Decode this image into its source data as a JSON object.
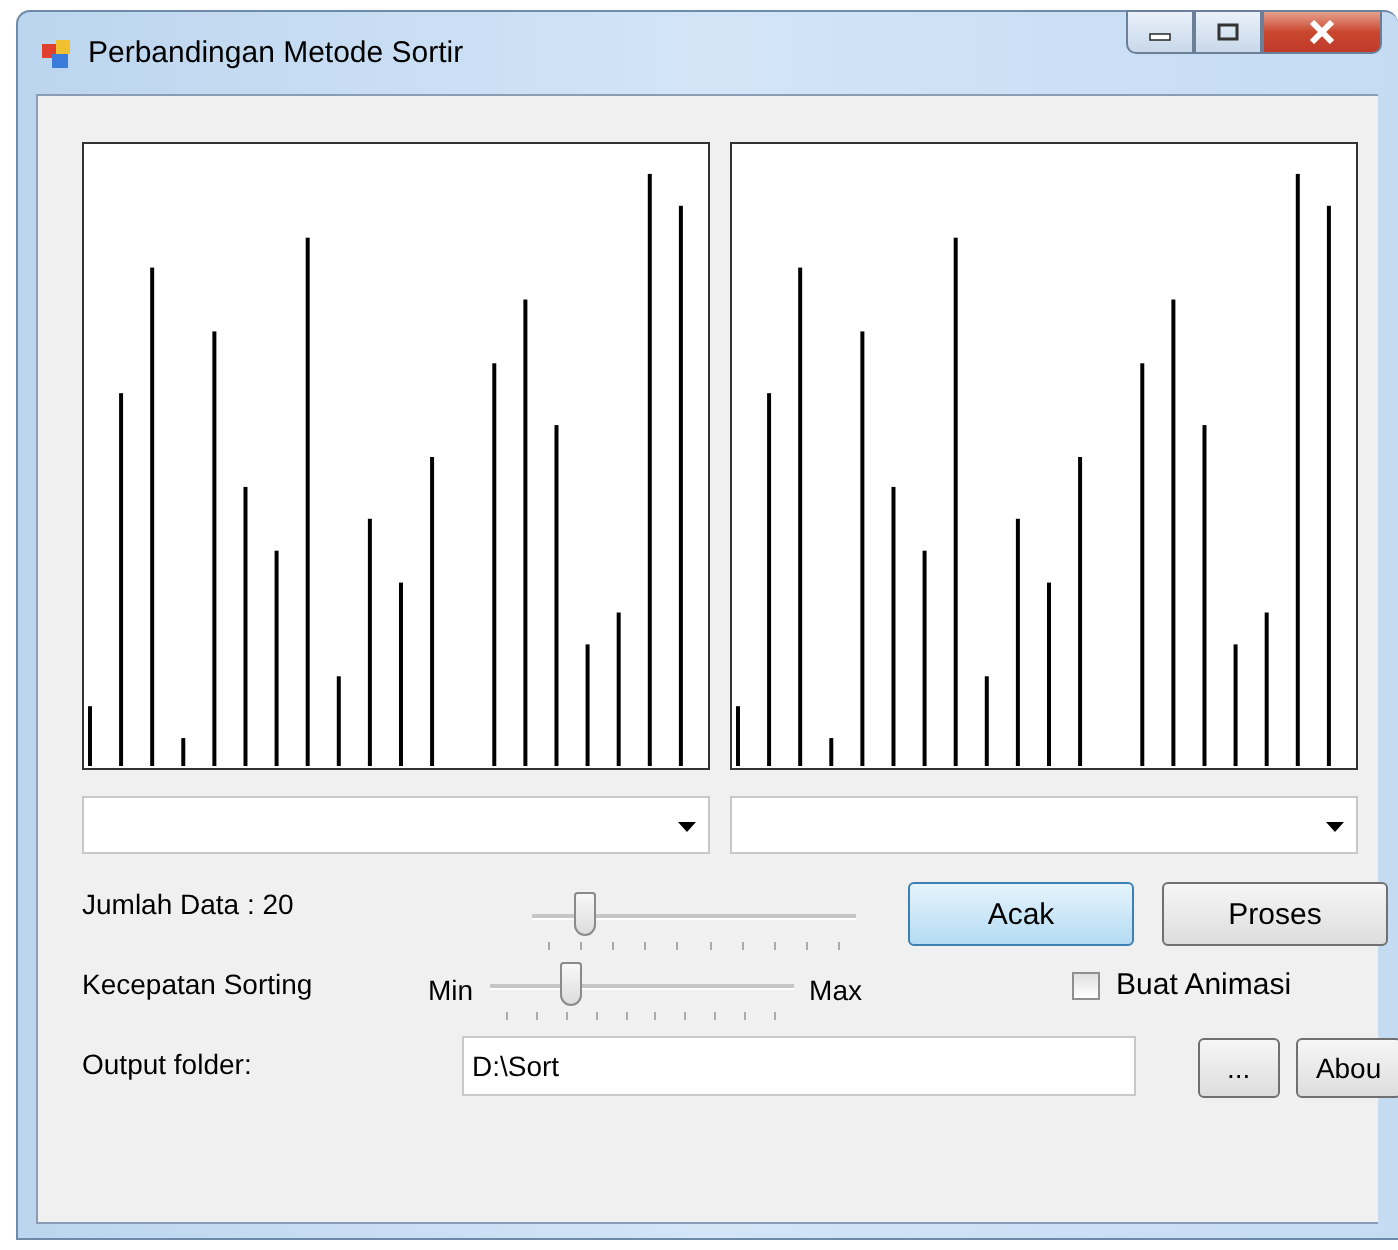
{
  "window": {
    "title": "Perbandingan Metode Sortir"
  },
  "panels": [
    {
      "kind": "bars"
    },
    {
      "kind": "bars"
    }
  ],
  "jumlah": {
    "label": "Jumlah Data : 20",
    "level": 0.13
  },
  "buttons": [
    {
      "label": "Acak",
      "selected": true
    },
    {
      "label": "Proses",
      "selected": false
    }
  ],
  "kecepatan": {
    "label": "Kecepatan Sorting",
    "min": "Min",
    "max": "Max",
    "level": 0.23
  },
  "animasi": {
    "label": "Buat Animasi",
    "checked": false
  },
  "output": {
    "label": "Output folder:",
    "value": "D:\\Sort"
  },
  "browse_button": "...",
  "about_button": "Abou"
}
